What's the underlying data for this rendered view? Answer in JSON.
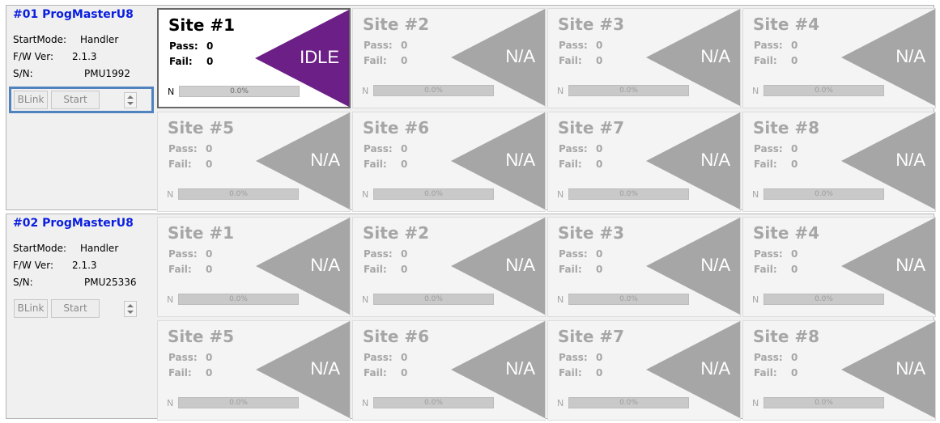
{
  "programmers": [
    {
      "title": "#01 ProgMasterU8",
      "start_mode_label": "StartMode:",
      "start_mode": "Handler",
      "fw_label": "F/W Ver:",
      "fw": "2.1.3",
      "sn_label": "S/N:",
      "sn": "PMU1992",
      "blink_label": "BLink",
      "start_label": "Start",
      "sites": [
        {
          "title": "Site #1",
          "pass_label": "Pass:",
          "pass": "0",
          "fail_label": "Fail:",
          "fail": "0",
          "status": "IDLE",
          "progress_letter": "N",
          "progress_text": "0.0%",
          "progress": 0
        },
        {
          "title": "Site #2",
          "pass_label": "Pass:",
          "pass": "0",
          "fail_label": "Fail:",
          "fail": "0",
          "status": "N/A",
          "progress_letter": "N",
          "progress_text": "0.0%",
          "progress": 0
        },
        {
          "title": "Site #3",
          "pass_label": "Pass:",
          "pass": "0",
          "fail_label": "Fail:",
          "fail": "0",
          "status": "N/A",
          "progress_letter": "N",
          "progress_text": "0.0%",
          "progress": 0
        },
        {
          "title": "Site #4",
          "pass_label": "Pass:",
          "pass": "0",
          "fail_label": "Fail:",
          "fail": "0",
          "status": "N/A",
          "progress_letter": "N",
          "progress_text": "0.0%",
          "progress": 0
        },
        {
          "title": "Site #5",
          "pass_label": "Pass:",
          "pass": "0",
          "fail_label": "Fail:",
          "fail": "0",
          "status": "N/A",
          "progress_letter": "N",
          "progress_text": "0.0%",
          "progress": 0
        },
        {
          "title": "Site #6",
          "pass_label": "Pass:",
          "pass": "0",
          "fail_label": "Fail:",
          "fail": "0",
          "status": "N/A",
          "progress_letter": "N",
          "progress_text": "0.0%",
          "progress": 0
        },
        {
          "title": "Site #7",
          "pass_label": "Pass:",
          "pass": "0",
          "fail_label": "Fail:",
          "fail": "0",
          "status": "N/A",
          "progress_letter": "N",
          "progress_text": "0.0%",
          "progress": 0
        },
        {
          "title": "Site #8",
          "pass_label": "Pass:",
          "pass": "0",
          "fail_label": "Fail:",
          "fail": "0",
          "status": "N/A",
          "progress_letter": "N",
          "progress_text": "0.0%",
          "progress": 0
        }
      ]
    },
    {
      "title": "#02 ProgMasterU8",
      "start_mode_label": "StartMode:",
      "start_mode": "Handler",
      "fw_label": "F/W Ver:",
      "fw": "2.1.3",
      "sn_label": "S/N:",
      "sn": "PMU25336",
      "blink_label": "BLink",
      "start_label": "Start",
      "sites": [
        {
          "title": "Site #1",
          "pass_label": "Pass:",
          "pass": "0",
          "fail_label": "Fail:",
          "fail": "0",
          "status": "N/A",
          "progress_letter": "N",
          "progress_text": "0.0%",
          "progress": 0
        },
        {
          "title": "Site #2",
          "pass_label": "Pass:",
          "pass": "0",
          "fail_label": "Fail:",
          "fail": "0",
          "status": "N/A",
          "progress_letter": "N",
          "progress_text": "0.0%",
          "progress": 0
        },
        {
          "title": "Site #3",
          "pass_label": "Pass:",
          "pass": "0",
          "fail_label": "Fail:",
          "fail": "0",
          "status": "N/A",
          "progress_letter": "N",
          "progress_text": "0.0%",
          "progress": 0
        },
        {
          "title": "Site #4",
          "pass_label": "Pass:",
          "pass": "0",
          "fail_label": "Fail:",
          "fail": "0",
          "status": "N/A",
          "progress_letter": "N",
          "progress_text": "0.0%",
          "progress": 0
        },
        {
          "title": "Site #5",
          "pass_label": "Pass:",
          "pass": "0",
          "fail_label": "Fail:",
          "fail": "0",
          "status": "N/A",
          "progress_letter": "N",
          "progress_text": "0.0%",
          "progress": 0
        },
        {
          "title": "Site #6",
          "pass_label": "Pass:",
          "pass": "0",
          "fail_label": "Fail:",
          "fail": "0",
          "status": "N/A",
          "progress_letter": "N",
          "progress_text": "0.0%",
          "progress": 0
        },
        {
          "title": "Site #7",
          "pass_label": "Pass:",
          "pass": "0",
          "fail_label": "Fail:",
          "fail": "0",
          "status": "N/A",
          "progress_letter": "N",
          "progress_text": "0.0%",
          "progress": 0
        },
        {
          "title": "Site #8",
          "pass_label": "Pass:",
          "pass": "0",
          "fail_label": "Fail:",
          "fail": "0",
          "status": "N/A",
          "progress_letter": "N",
          "progress_text": "0.0%",
          "progress": 0
        }
      ]
    }
  ],
  "colors": {
    "title_blue": "#0a1ee0",
    "idle_purple": "#6c1f87",
    "na_gray": "#a6a6a6",
    "highlight_blue": "#4f82be"
  }
}
